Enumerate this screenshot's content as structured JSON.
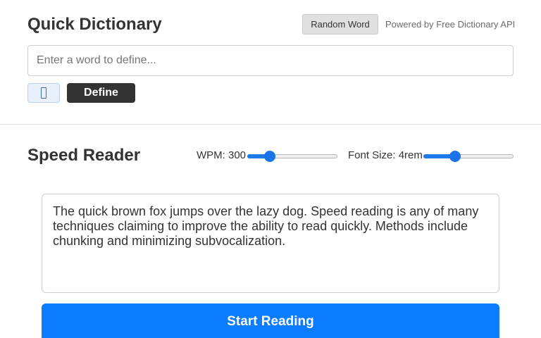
{
  "dictionary": {
    "title": "Quick Dictionary",
    "random_label": "Random Word",
    "powered_by": "Powered by Free Dictionary API",
    "input_value": "",
    "input_placeholder": "Enter a word to define...",
    "speak_icon": "speaker-icon",
    "define_label": "Define"
  },
  "reader": {
    "title": "Speed Reader",
    "wpm_label": "WPM: 300",
    "wpm_level_fraction": 0.25,
    "font_label": "Font Size: 4rem",
    "font_level_fraction": 0.35,
    "text": "The quick brown fox jumps over the lazy dog. Speed reading is any of many techniques claiming to improve the ability to read quickly. Methods include chunking and minimizing subvocalization.",
    "start_label": "Start Reading"
  },
  "colors": {
    "accent": "#0b7cff",
    "dark_button": "#333333",
    "slider_thumb": "#1a73e8"
  }
}
